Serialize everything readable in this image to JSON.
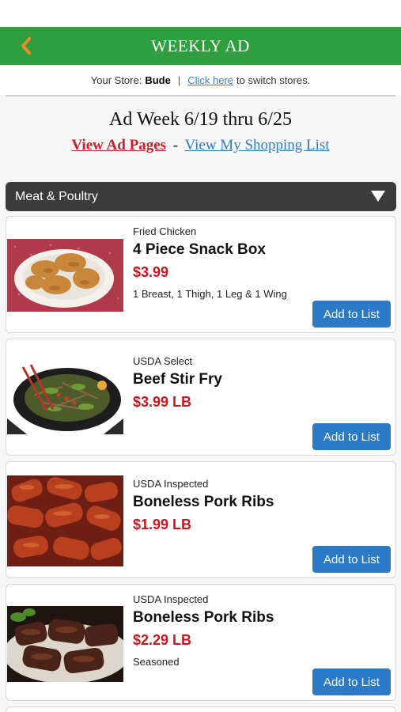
{
  "header": {
    "title": "WEEKLY AD",
    "back_icon": "chevron-left-icon"
  },
  "store": {
    "prefix": "Your Store:",
    "name": "Bude",
    "separator": "|",
    "switch_link": "Click here",
    "switch_suffix": "to switch stores."
  },
  "ad": {
    "week_label": "Ad Week 6/19 thru 6/25",
    "view_pages": "View Ad Pages",
    "dash": "-",
    "view_list": "View My Shopping List"
  },
  "category": {
    "label": "Meat & Poultry"
  },
  "items": [
    {
      "subtitle": "Fried Chicken",
      "title": "4 Piece Snack Box",
      "price": "$3.99",
      "desc": "1 Breast, 1 Thigh, 1 Leg & 1 Wing",
      "button": "Add to List"
    },
    {
      "subtitle": "USDA Select",
      "title": "Beef Stir Fry",
      "price": "$3.99 LB",
      "desc": "",
      "button": "Add to List"
    },
    {
      "subtitle": "USDA Inspected",
      "title": "Boneless Pork Ribs",
      "price": "$1.99 LB",
      "desc": "",
      "button": "Add to List"
    },
    {
      "subtitle": "USDA Inspected",
      "title": "Boneless Pork Ribs",
      "price": "$2.29 LB",
      "desc": "Seasoned",
      "button": "Add to List"
    }
  ],
  "colors": {
    "header_green": "#2e9e3e",
    "back_orange": "#f08a24",
    "price_red": "#c8161d",
    "button_blue": "#2a7ac7"
  }
}
